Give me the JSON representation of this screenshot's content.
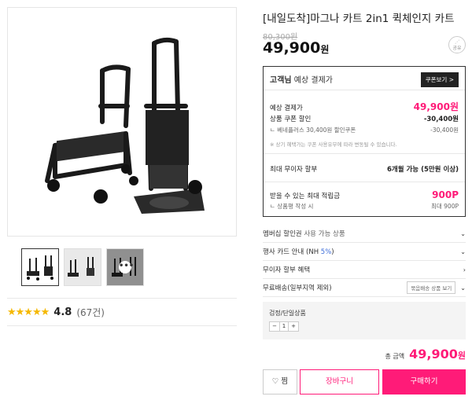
{
  "product": {
    "title": "[내일도착]마그나 카트 2in1 퀵체인지 카트",
    "original_price": "80,300원",
    "price": "49,900",
    "price_unit": "원",
    "share_label": "공유"
  },
  "gallery": {
    "thumbs_count": 3,
    "more_label": "•••"
  },
  "rating": {
    "stars": "★★★★★",
    "score": "4.8",
    "count": "(67건)"
  },
  "payment": {
    "header_bold": "고객님",
    "header_rest": " 예상 결제가",
    "coupon_button": "쿠폰보기 >",
    "expected_label": "예상 결제가",
    "expected_value": "49,900원",
    "coupon_label": "상품 쿠폰 할인",
    "coupon_value": "-30,400원",
    "coupon_sub_label": "ㄴ 베네플러스 30,400원 할인쿠폰",
    "coupon_sub_value": "-30,400원",
    "note": "※ 상기 혜택가는 쿠폰 사용유무에 따라 변동될 수 있습니다.",
    "installment_label": "최대 무이자 할부",
    "installment_value": "6개월 가능 (5만원 이상)",
    "points_label": "받을 수 있는 최대 적립금",
    "points_value": "900P",
    "points_sub_label": "ㄴ 상품평 작성 시",
    "points_sub_value": "최대 900P"
  },
  "accordions": [
    {
      "label_main": "멤버십 할인권",
      "label_sub": " 사용 가능 상품"
    },
    {
      "label_main": "행사 카드 안내 (NH ",
      "label_sub": "5%",
      "label_end": ")"
    },
    {
      "label_main": "무이자 할부 혜택"
    },
    {
      "label_main": "무료배송(일부지역 제외)",
      "button": "묶음배송 상품 보기"
    }
  ],
  "option": {
    "title": "검정/단일상품",
    "minus": "−",
    "qty": "1",
    "plus": "+"
  },
  "total": {
    "label": "총 금액",
    "value": "49,900",
    "unit": "원"
  },
  "buttons": {
    "like": "♡ 찜",
    "cart": "장바구니",
    "buy": "구매하기"
  }
}
